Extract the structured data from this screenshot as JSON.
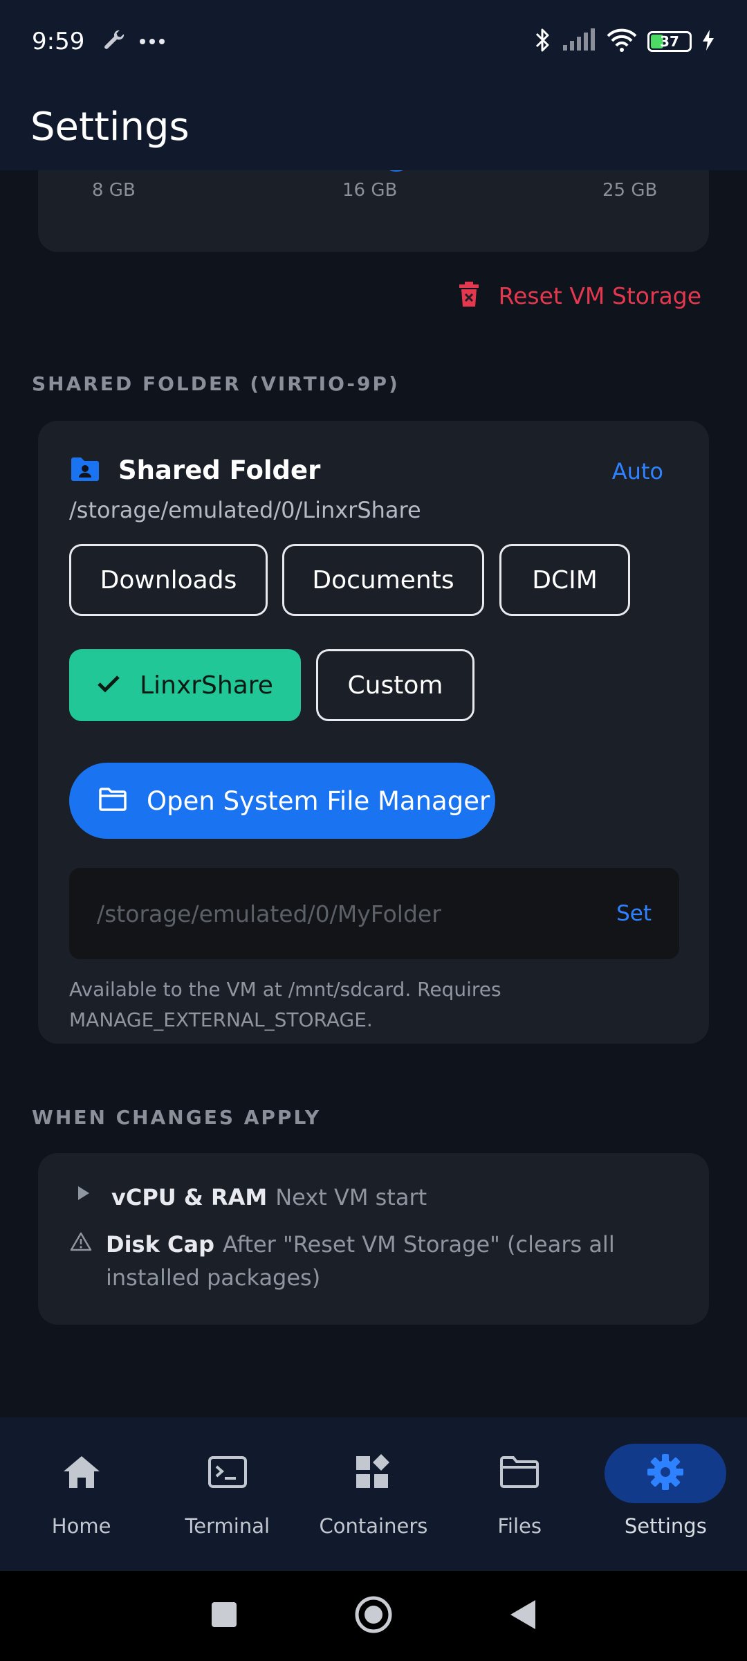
{
  "status_bar": {
    "time": "9:59",
    "battery_level": "37",
    "icons": [
      "wrench-icon",
      "more-dots-icon",
      "bluetooth-icon",
      "signal-icon",
      "wifi-icon",
      "battery-icon",
      "charging-icon"
    ]
  },
  "app_bar": {
    "title": "Settings"
  },
  "storage": {
    "tick_labels": [
      "8 GB",
      "16 GB",
      "25 GB"
    ],
    "value_gb": 16,
    "min_gb": 8,
    "max_gb": 25,
    "reset_label": "Reset VM Storage",
    "reset_color": "#e5384f"
  },
  "shared_folder": {
    "section_header": "SHARED FOLDER (VIRTIO-9P)",
    "title": "Shared Folder",
    "auto_label": "Auto",
    "current_path": "/storage/emulated/0/LinxrShare",
    "presets": [
      {
        "label": "Downloads",
        "selected": false
      },
      {
        "label": "Documents",
        "selected": false
      },
      {
        "label": "DCIM",
        "selected": false
      },
      {
        "label": "LinxrShare",
        "selected": true
      },
      {
        "label": "Custom",
        "selected": false
      }
    ],
    "open_fm_label": "Open System File Manager",
    "path_placeholder": "/storage/emulated/0/MyFolder",
    "set_label": "Set",
    "help_text": "Available to the VM at /mnt/sdcard. Requires MANAGE_EXTERNAL_STORAGE."
  },
  "changes_apply": {
    "section_header": "WHEN CHANGES APPLY",
    "rows": [
      {
        "key": "vCPU & RAM",
        "value": "Next VM start",
        "icon": "play-icon"
      },
      {
        "key": "Disk Cap",
        "value": "After \"Reset VM Storage\" (clears all installed packages)",
        "icon": "warning-icon"
      }
    ]
  },
  "bottom_nav": {
    "items": [
      {
        "label": "Home",
        "icon": "home-icon"
      },
      {
        "label": "Terminal",
        "icon": "terminal-icon"
      },
      {
        "label": "Containers",
        "icon": "containers-icon"
      },
      {
        "label": "Files",
        "icon": "folder-icon"
      },
      {
        "label": "Settings",
        "icon": "gear-icon",
        "active": true
      }
    ]
  },
  "colors": {
    "accent": "#1a73f0",
    "selected_chip": "#21c796",
    "danger": "#e5384f",
    "link": "#2f82ff"
  }
}
